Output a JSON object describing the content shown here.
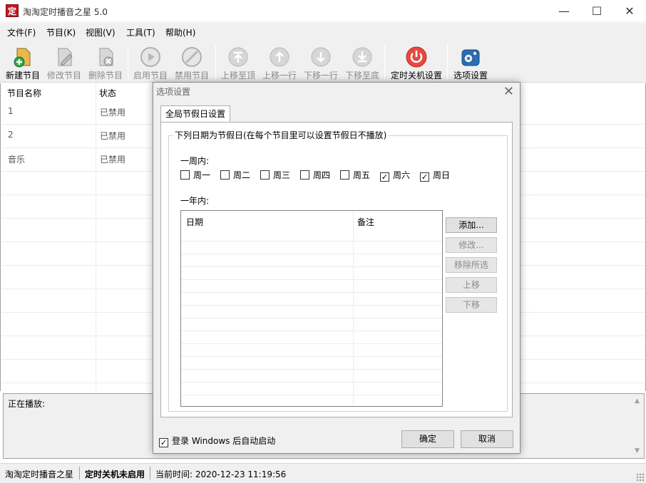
{
  "app": {
    "title": "淘淘定时播音之星 5.0",
    "icon_text": "定",
    "window_controls": {
      "minimize": "—",
      "maximize": "☐",
      "close": "✕"
    }
  },
  "menu": [
    "文件(F)",
    "节目(K)",
    "视图(V)",
    "工具(T)",
    "帮助(H)"
  ],
  "toolbar": [
    {
      "label": "新建节目",
      "icon": "new-program-icon",
      "enabled": true
    },
    {
      "label": "修改节目",
      "icon": "edit-program-icon",
      "enabled": false
    },
    {
      "label": "删除节目",
      "icon": "delete-program-icon",
      "enabled": false
    },
    {
      "label": "启用节目",
      "icon": "enable-program-icon",
      "enabled": false
    },
    {
      "label": "禁用节目",
      "icon": "disable-program-icon",
      "enabled": false
    },
    {
      "label": "上移至顶",
      "icon": "move-top-icon",
      "enabled": false
    },
    {
      "label": "上移一行",
      "icon": "move-up-icon",
      "enabled": false
    },
    {
      "label": "下移一行",
      "icon": "move-down-icon",
      "enabled": false
    },
    {
      "label": "下移至底",
      "icon": "move-bottom-icon",
      "enabled": false
    },
    {
      "label": "定时关机设置",
      "icon": "power-icon",
      "enabled": true
    },
    {
      "label": "选项设置",
      "icon": "settings-gear-icon",
      "enabled": true
    }
  ],
  "program_list": {
    "columns": [
      "节目名称",
      "状态"
    ],
    "rows": [
      {
        "name": "1",
        "status": "已禁用"
      },
      {
        "name": "2",
        "status": "已禁用"
      },
      {
        "name": "音乐",
        "status": "已禁用"
      }
    ]
  },
  "now_playing": {
    "label": "正在播放:"
  },
  "statusbar": {
    "app_name": "淘淘定时播音之星",
    "shutdown_status": "定时关机未启用",
    "current_time": "当前时间: 2020-12-23 11:19:56"
  },
  "dialog": {
    "title": "选项设置",
    "close_icon": "✕",
    "tab": "全局节假日设置",
    "group_title": "下列日期为节假日(在每个节目里可以设置节假日不播放)",
    "week_label": "一周内:",
    "weekdays": [
      {
        "label": "周一",
        "checked": false
      },
      {
        "label": "周二",
        "checked": false
      },
      {
        "label": "周三",
        "checked": false
      },
      {
        "label": "周四",
        "checked": false
      },
      {
        "label": "周五",
        "checked": false
      },
      {
        "label": "周六",
        "checked": true
      },
      {
        "label": "周日",
        "checked": true
      }
    ],
    "year_label": "一年内:",
    "date_list": {
      "columns": [
        "日期",
        "备注"
      ]
    },
    "side_buttons": [
      {
        "label": "添加...",
        "enabled": true
      },
      {
        "label": "修改...",
        "enabled": false
      },
      {
        "label": "移除所选",
        "enabled": false
      },
      {
        "label": "上移",
        "enabled": false
      },
      {
        "label": "下移",
        "enabled": false
      }
    ],
    "autostart": {
      "label": "登录 Windows 后自动启动",
      "checked": true
    },
    "ok_label": "确定",
    "cancel_label": "取消"
  }
}
